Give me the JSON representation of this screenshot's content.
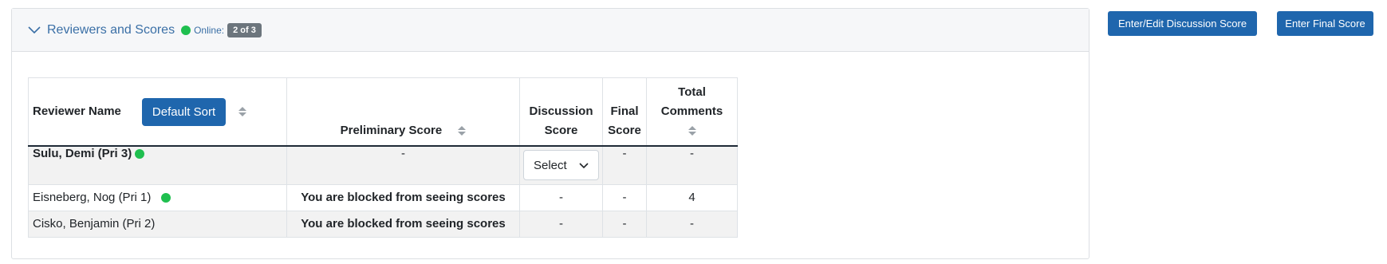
{
  "panel": {
    "title": "Reviewers and Scores",
    "online_label": "Online:",
    "online_badge": "2 of 3"
  },
  "table": {
    "headers": {
      "reviewer_name": "Reviewer Name",
      "default_sort": "Default Sort",
      "preliminary_score": "Preliminary Score",
      "discussion_line1": "Discussion",
      "discussion_line2": "Score",
      "final_line1": "Final",
      "final_line2": "Score",
      "total_line1": "Total",
      "total_line2": "Comments"
    },
    "rows": [
      {
        "name": "Sulu, Demi (Pri 3)",
        "online": true,
        "preliminary": "-",
        "discussion": "Select",
        "final": "-",
        "total": "-"
      },
      {
        "name": "Eisneberg, Nog (Pri 1)",
        "online": true,
        "preliminary": "You are blocked from seeing scores",
        "discussion": "-",
        "final": "-",
        "total": "4"
      },
      {
        "name": "Cisko, Benjamin (Pri 2)",
        "online": false,
        "preliminary": "You are blocked from seeing scores",
        "discussion": "-",
        "final": "-",
        "total": "-"
      }
    ]
  },
  "buttons": {
    "discussion": "Enter/Edit Discussion Score",
    "final": "Enter Final Score"
  },
  "colors": {
    "primary": "#1f66ad",
    "online": "#1fbf4f",
    "link": "#3a6fa6"
  },
  "icons": {
    "collapse": "chevron-down-icon",
    "sort": "sort-arrows-icon",
    "select": "chevron-down-icon"
  }
}
